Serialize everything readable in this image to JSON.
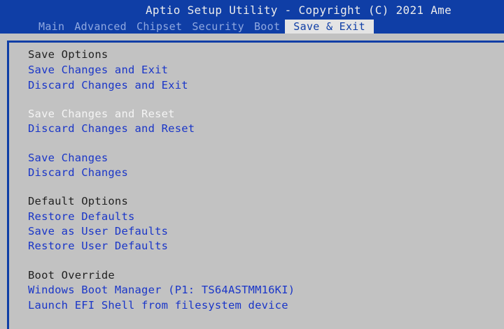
{
  "header": {
    "title": "Aptio Setup Utility - Copyright (C) 2021 Ame",
    "tabs": [
      "Main",
      "Advanced",
      "Chipset",
      "Security",
      "Boot",
      "Save & Exit"
    ],
    "active_tab": "Save & Exit"
  },
  "menu": {
    "save_options": {
      "heading": "Save Options",
      "items": [
        "Save Changes and Exit",
        "Discard Changes and Exit"
      ]
    },
    "reset_options": {
      "items": [
        "Save Changes and Reset",
        "Discard Changes and Reset"
      ],
      "selected": "Save Changes and Reset"
    },
    "change_options": {
      "items": [
        "Save Changes",
        "Discard Changes"
      ]
    },
    "default_options": {
      "heading": "Default Options",
      "items": [
        "Restore Defaults",
        "Save as User Defaults",
        "Restore User Defaults"
      ]
    },
    "boot_override": {
      "heading": "Boot Override",
      "items": [
        "Windows Boot Manager (P1: TS64ASTMM16KI)",
        "Launch EFI Shell from filesystem device"
      ]
    }
  },
  "colors": {
    "header_bg": "#0f3ea6",
    "body_bg": "#c2c2c2",
    "option_text": "#1a36c8",
    "selected_text": "#f4f4f4",
    "heading_text": "#222222"
  }
}
